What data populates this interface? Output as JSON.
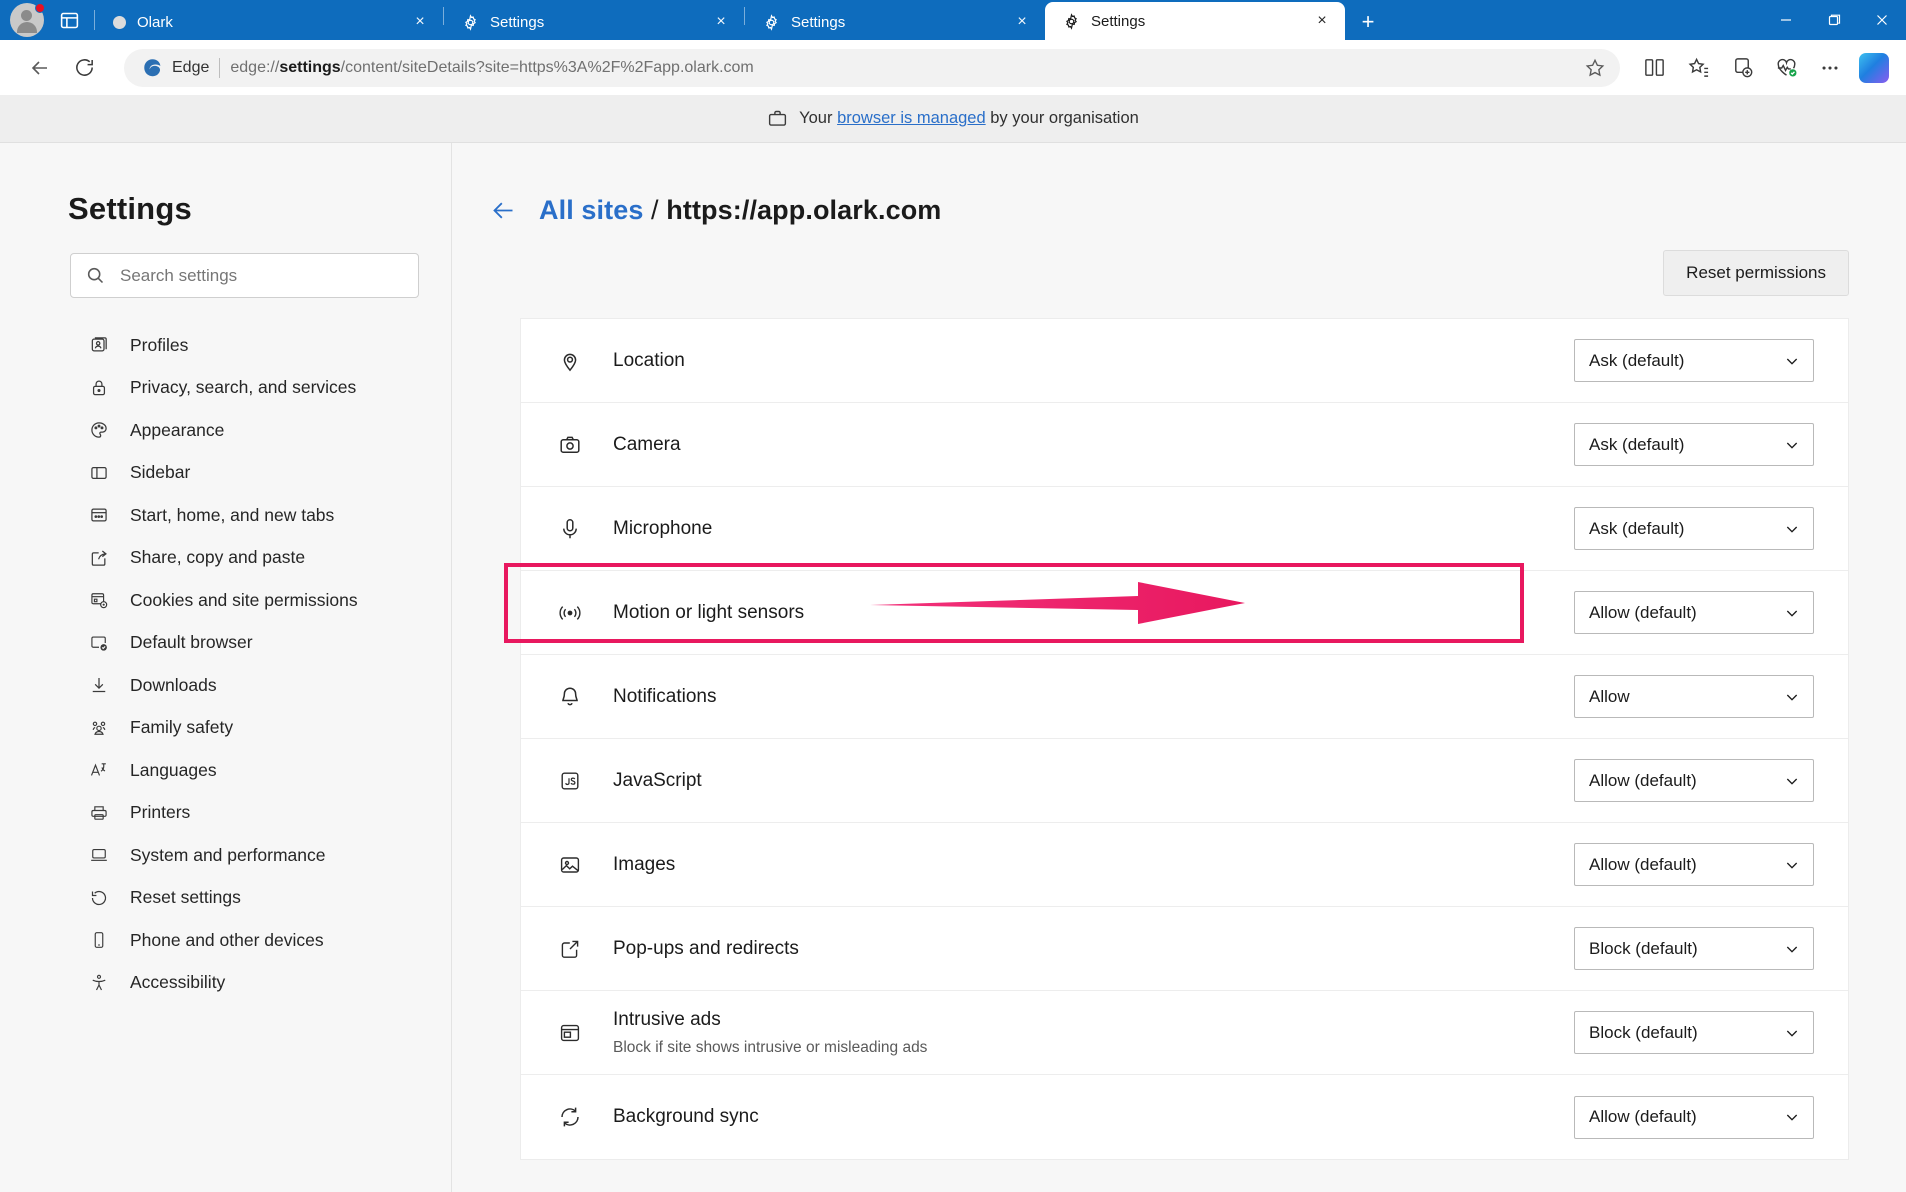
{
  "browser": {
    "tabstrip": {
      "avatar_name": "profile-avatar",
      "tab_search_title": "Tab actions",
      "tabs": [
        {
          "title": "Olark",
          "favicon": "dot-favicon",
          "active": false,
          "close_label": "×"
        },
        {
          "title": "Settings",
          "favicon": "gear-icon",
          "active": false,
          "close_label": "×"
        },
        {
          "title": "Settings",
          "favicon": "gear-icon",
          "active": false,
          "close_label": "×"
        },
        {
          "title": "Settings",
          "favicon": "gear-icon",
          "active": true,
          "close_label": "×"
        }
      ],
      "new_tab_label": "+",
      "window_controls": {
        "minimize": "─",
        "maximize": "❐",
        "close": "✕"
      }
    },
    "toolbar": {
      "back_label": "←",
      "refresh_label": "↻",
      "edge_chip_label": "Edge",
      "url_prefix": "edge://",
      "url_bold": "settings",
      "url_suffix": "/content/siteDetails?site=https%3A%2F%2Fapp.olark.com",
      "url_full": "edge://settings/content/siteDetails?site=https%3A%2F%2Fapp.olark.com",
      "favorite_title": "Add this page to favourites",
      "split_screen_title": "Split screen",
      "favorites_title": "Favourites",
      "collections_title": "Collections",
      "browser_essentials_title": "Browser essentials",
      "settings_more_title": "Settings and more",
      "copilot_title": "Copilot"
    },
    "managed_banner": {
      "prefix": "Your ",
      "link": "browser is managed",
      "suffix": " by your organisation",
      "icon": "briefcase-icon"
    }
  },
  "settings": {
    "title": "Settings",
    "search": {
      "placeholder": "Search settings",
      "value": "",
      "icon": "search-icon"
    },
    "nav_items": [
      {
        "label": "Profiles",
        "icon": "profiles-icon"
      },
      {
        "label": "Privacy, search, and services",
        "icon": "lock-icon"
      },
      {
        "label": "Appearance",
        "icon": "palette-icon"
      },
      {
        "label": "Sidebar",
        "icon": "sidebar-icon"
      },
      {
        "label": "Start, home, and new tabs",
        "icon": "window-icon"
      },
      {
        "label": "Share, copy and paste",
        "icon": "share-icon"
      },
      {
        "label": "Cookies and site permissions",
        "icon": "cookies-icon"
      },
      {
        "label": "Default browser",
        "icon": "default-browser-icon"
      },
      {
        "label": "Downloads",
        "icon": "download-icon"
      },
      {
        "label": "Family safety",
        "icon": "family-icon"
      },
      {
        "label": "Languages",
        "icon": "languages-icon"
      },
      {
        "label": "Printers",
        "icon": "printer-icon"
      },
      {
        "label": "System and performance",
        "icon": "laptop-icon"
      },
      {
        "label": "Reset settings",
        "icon": "reset-icon"
      },
      {
        "label": "Phone and other devices",
        "icon": "phone-icon"
      },
      {
        "label": "Accessibility",
        "icon": "accessibility-icon"
      }
    ]
  },
  "main": {
    "back_arrow": "←",
    "breadcrumb_link": "All sites",
    "breadcrumb_separator": " / ",
    "breadcrumb_current": "https://app.olark.com",
    "reset_permissions_label": "Reset permissions",
    "highlight_color": "#e8185f",
    "permissions": [
      {
        "label": "Location",
        "icon": "location-icon",
        "value": "Ask (default)",
        "sub": "",
        "highlighted": false
      },
      {
        "label": "Camera",
        "icon": "camera-icon",
        "value": "Ask (default)",
        "sub": "",
        "highlighted": false
      },
      {
        "label": "Microphone",
        "icon": "microphone-icon",
        "value": "Ask (default)",
        "sub": "",
        "highlighted": false
      },
      {
        "label": "Motion or light sensors",
        "icon": "sensors-icon",
        "value": "Allow (default)",
        "sub": "",
        "highlighted": false
      },
      {
        "label": "Notifications",
        "icon": "bell-icon",
        "value": "Allow",
        "sub": "",
        "highlighted": true
      },
      {
        "label": "JavaScript",
        "icon": "javascript-icon",
        "value": "Allow (default)",
        "sub": "",
        "highlighted": false
      },
      {
        "label": "Images",
        "icon": "images-icon",
        "value": "Allow (default)",
        "sub": "",
        "highlighted": false
      },
      {
        "label": "Pop-ups and redirects",
        "icon": "popup-icon",
        "value": "Block (default)",
        "sub": "",
        "highlighted": false
      },
      {
        "label": "Intrusive ads",
        "icon": "ads-icon",
        "value": "Block (default)",
        "sub": "Block if site shows intrusive or misleading ads",
        "highlighted": false
      },
      {
        "label": "Background sync",
        "icon": "sync-icon",
        "value": "Allow (default)",
        "sub": "",
        "highlighted": false
      }
    ],
    "chevron": "∨"
  }
}
